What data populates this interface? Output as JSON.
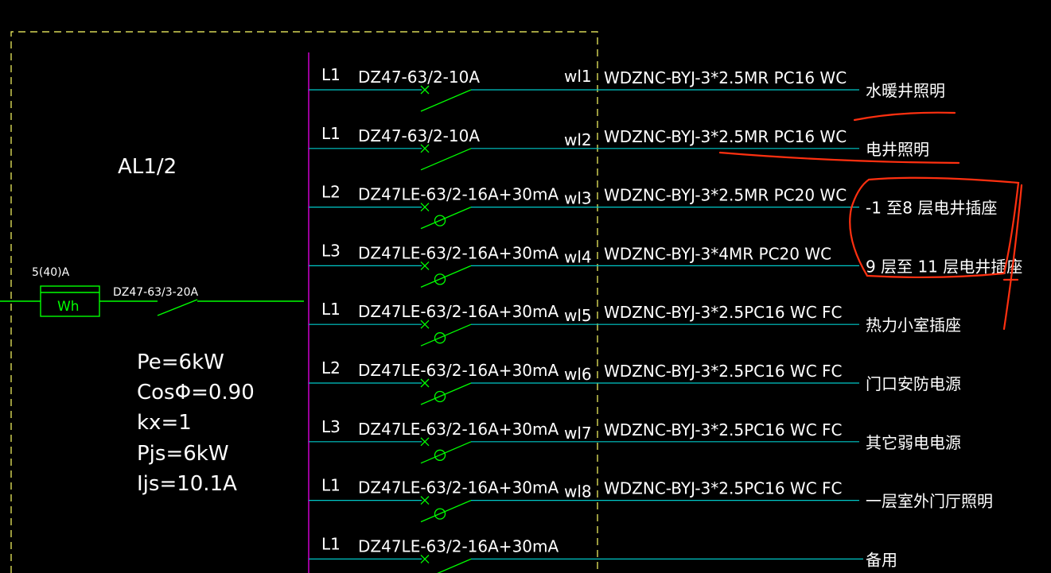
{
  "panel": {
    "name": "AL1/2",
    "meter_rating": "5(40)A",
    "meter_label": "Wh",
    "main_breaker": "DZ47-63/3-20A",
    "params": [
      "Pe=6kW",
      "CosΦ=0.90",
      "kx=1",
      "Pjs=6kW",
      "Ijs=10.1A"
    ]
  },
  "circuits": [
    {
      "phase": "L1",
      "breaker": "DZ47-63/2-10A",
      "id": "wl1",
      "cable": "WDZNC-BYJ-3*2.5MR PC16 WC",
      "load": "水暖井照明",
      "rcd": false
    },
    {
      "phase": "L1",
      "breaker": "DZ47-63/2-10A",
      "id": "wl2",
      "cable": "WDZNC-BYJ-3*2.5MR PC16 WC",
      "load": "电井照明",
      "rcd": false
    },
    {
      "phase": "L2",
      "breaker": "DZ47LE-63/2-16A+30mA",
      "id": "wl3",
      "cable": "WDZNC-BYJ-3*2.5MR PC20 WC",
      "load": "-1 至8 层电井插座",
      "rcd": true
    },
    {
      "phase": "L3",
      "breaker": "DZ47LE-63/2-16A+30mA",
      "id": "wl4",
      "cable": "WDZNC-BYJ-3*4MR PC20 WC",
      "load": "9 层至 11 层电井插座",
      "rcd": true
    },
    {
      "phase": "L1",
      "breaker": "DZ47LE-63/2-16A+30mA",
      "id": "wl5",
      "cable": "WDZNC-BYJ-3*2.5PC16 WC FC",
      "load": "热力小室插座",
      "rcd": true
    },
    {
      "phase": "L2",
      "breaker": "DZ47LE-63/2-16A+30mA",
      "id": "wl6",
      "cable": "WDZNC-BYJ-3*2.5PC16 WC FC",
      "load": "门口安防电源",
      "rcd": true
    },
    {
      "phase": "L3",
      "breaker": "DZ47LE-63/2-16A+30mA",
      "id": "wl7",
      "cable": "WDZNC-BYJ-3*2.5PC16 WC FC",
      "load": "其它弱电电源",
      "rcd": true
    },
    {
      "phase": "L1",
      "breaker": "DZ47LE-63/2-16A+30mA",
      "id": "wl8",
      "cable": "WDZNC-BYJ-3*2.5PC16 WC FC",
      "load": "一层室外门厅照明",
      "rcd": true
    },
    {
      "phase": "L1",
      "breaker": "DZ47LE-63/2-16A+30mA",
      "id": "",
      "cable": "",
      "load": "备用",
      "rcd": false
    }
  ],
  "colors": {
    "background": "#000000",
    "text": "#ffffff",
    "line": "#00c8c8",
    "switch": "#00ff00",
    "busbar": "#c000c0",
    "frame": "#ffff66",
    "annotation": "#ff3010"
  }
}
